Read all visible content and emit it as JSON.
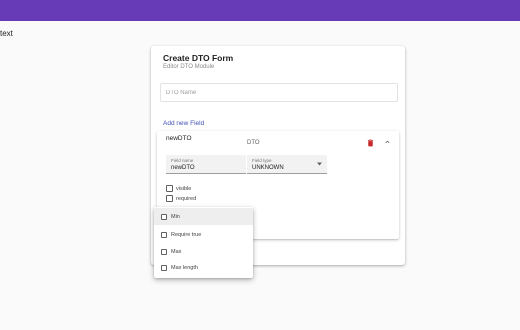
{
  "page": {
    "text": "text"
  },
  "form": {
    "title": "Create DTO Form",
    "subtitle": "Editor DTO Module",
    "name_placeholder": "DTO Name",
    "add_field_label": "Add new Field"
  },
  "field": {
    "name": "newDTO",
    "type_caption": "DTO",
    "field_name_label": "Field name",
    "field_name_value": "newDTO",
    "field_type_label": "Field type",
    "field_type_value": "UNKNOWN",
    "checkboxes": [
      {
        "label": "visible",
        "checked": false
      },
      {
        "label": "required",
        "checked": false
      }
    ]
  },
  "dropdown": {
    "items": [
      {
        "label": "Min",
        "checked": false,
        "active": true
      },
      {
        "label": "Require true",
        "checked": false
      },
      {
        "label": "Max",
        "checked": false
      },
      {
        "label": "Max length",
        "checked": false
      }
    ]
  },
  "colors": {
    "primary": "#673ab7",
    "link": "#3f51b5",
    "delete": "#c62828"
  },
  "icons": [
    "delete-icon",
    "chevron-up-icon",
    "dropdown-arrow-icon",
    "checkbox-icon"
  ]
}
